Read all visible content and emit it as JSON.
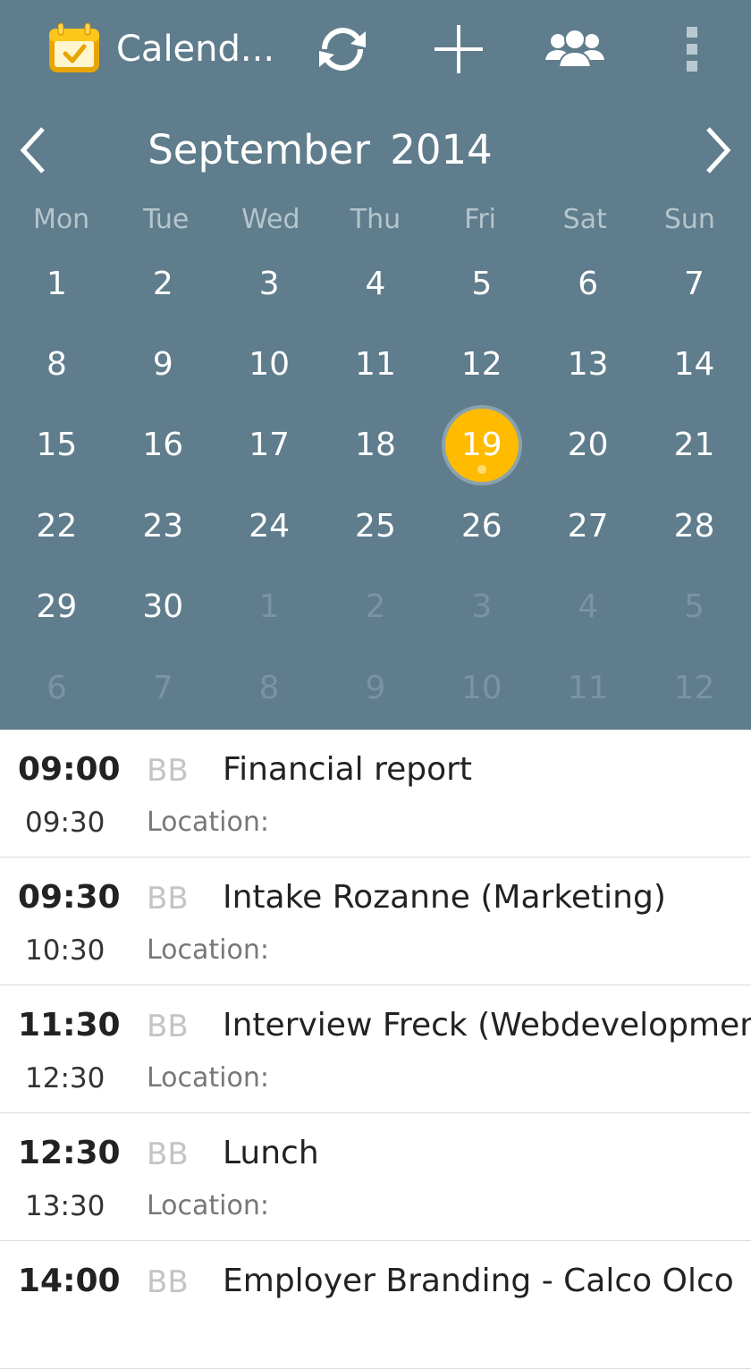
{
  "app": {
    "title": "Calend..."
  },
  "calendar": {
    "month_title": "September 2014",
    "weekdays": [
      "Mon",
      "Tue",
      "Wed",
      "Thu",
      "Fri",
      "Sat",
      "Sun"
    ],
    "weeks": [
      [
        {
          "d": "1"
        },
        {
          "d": "2"
        },
        {
          "d": "3"
        },
        {
          "d": "4"
        },
        {
          "d": "5"
        },
        {
          "d": "6"
        },
        {
          "d": "7"
        }
      ],
      [
        {
          "d": "8"
        },
        {
          "d": "9"
        },
        {
          "d": "10"
        },
        {
          "d": "11"
        },
        {
          "d": "12"
        },
        {
          "d": "13"
        },
        {
          "d": "14"
        }
      ],
      [
        {
          "d": "15"
        },
        {
          "d": "16"
        },
        {
          "d": "17"
        },
        {
          "d": "18"
        },
        {
          "d": "19",
          "selected": true,
          "has_events": true
        },
        {
          "d": "20"
        },
        {
          "d": "21"
        }
      ],
      [
        {
          "d": "22"
        },
        {
          "d": "23"
        },
        {
          "d": "24"
        },
        {
          "d": "25"
        },
        {
          "d": "26"
        },
        {
          "d": "27"
        },
        {
          "d": "28"
        }
      ],
      [
        {
          "d": "29"
        },
        {
          "d": "30"
        },
        {
          "d": "1",
          "muted": true
        },
        {
          "d": "2",
          "muted": true
        },
        {
          "d": "3",
          "muted": true
        },
        {
          "d": "4",
          "muted": true
        },
        {
          "d": "5",
          "muted": true
        }
      ],
      [
        {
          "d": "6",
          "muted": true
        },
        {
          "d": "7",
          "muted": true
        },
        {
          "d": "8",
          "muted": true
        },
        {
          "d": "9",
          "muted": true
        },
        {
          "d": "10",
          "muted": true
        },
        {
          "d": "11",
          "muted": true
        },
        {
          "d": "12",
          "muted": true
        }
      ]
    ]
  },
  "events": [
    {
      "start": "09:00",
      "end": "09:30",
      "calendar": "BB",
      "title": "Financial report",
      "location": "Location:"
    },
    {
      "start": "09:30",
      "end": "10:30",
      "calendar": "BB",
      "title": "Intake Rozanne (Marketing)",
      "location": "Location:"
    },
    {
      "start": "11:30",
      "end": "12:30",
      "calendar": "BB",
      "title": "Interview Freck (Webdevelopment)",
      "location": "Location:"
    },
    {
      "start": "12:30",
      "end": "13:30",
      "calendar": "BB",
      "title": "Lunch",
      "location": "Location:"
    },
    {
      "start": "14:00",
      "end": "",
      "calendar": "BB",
      "title": "Employer Branding - Calco Olco",
      "location": ""
    }
  ],
  "icons": {
    "app_logo": "calendar-check-icon",
    "sync": "sync-icon",
    "add": "plus-icon",
    "accounts": "people-icon",
    "overflow": "overflow-menu-icon",
    "prev": "chevron-left-icon",
    "next": "chevron-right-icon"
  },
  "colors": {
    "header_bg": "#5f7d8c",
    "selected_day": "#ffbb00",
    "muted_day": "#7994a2",
    "weekday_label": "#b5c5cd"
  }
}
